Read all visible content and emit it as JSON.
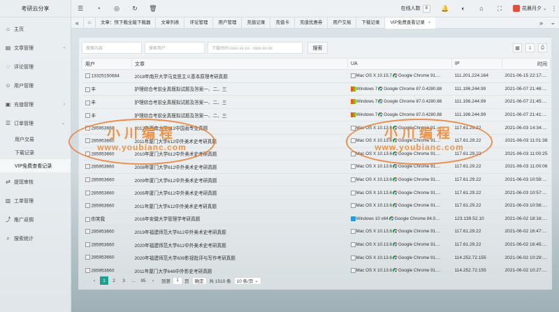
{
  "brand": "考研云分享",
  "sidebar": {
    "items": [
      {
        "label": "主页",
        "icon": "home-icon",
        "chev": ""
      },
      {
        "label": "文章管理",
        "icon": "document-icon",
        "chev": "‹"
      },
      {
        "label": "评论管理",
        "icon": "comment-icon",
        "chev": ""
      },
      {
        "label": "用户管理",
        "icon": "user-icon",
        "chev": ""
      },
      {
        "label": "充值管理",
        "icon": "wallet-icon",
        "chev": "‹"
      },
      {
        "label": "订单管理",
        "icon": "order-icon",
        "chev": "⌄"
      }
    ],
    "subitems": [
      {
        "label": "用户交易"
      },
      {
        "label": "下载记录"
      },
      {
        "label": "VIP免费查看记录"
      }
    ],
    "items2": [
      {
        "label": "提现审核",
        "icon": "withdraw-icon"
      },
      {
        "label": "工单管理",
        "icon": "ticket-icon"
      },
      {
        "label": "推广返佣",
        "icon": "share-icon"
      },
      {
        "label": "搜索统计",
        "icon": "search-stats-icon"
      }
    ]
  },
  "topbar": {
    "online_label": "在线人数",
    "online_count": "8",
    "user_name": "花晨月夕"
  },
  "tabs": [
    {
      "label": "文章：快下载全能下载器"
    },
    {
      "label": "文章列表"
    },
    {
      "label": "评论管理"
    },
    {
      "label": "用户管理"
    },
    {
      "label": "充值记录"
    },
    {
      "label": "充值卡"
    },
    {
      "label": "充值优惠券"
    },
    {
      "label": "用户交易"
    },
    {
      "label": "下载记录"
    },
    {
      "label": "VIP免费查看记录"
    }
  ],
  "search": {
    "user_placeholder": "搜索内容",
    "post_placeholder": "搜索用户",
    "time_placeholder": "下载时间 xxxx-xx-xx - xxxx-xx-xx",
    "button": "搜索"
  },
  "table": {
    "headers": [
      "用户",
      "文章",
      "UA",
      "IP",
      "时间"
    ],
    "rows": [
      {
        "user": "13325150684",
        "post": "2018年南开大学马克思主义基本原理考研真题",
        "os": "apple",
        "ua": "Mac OS X 10.15.7",
        "browser": "Google Chrome 91....",
        "ip": "111.201.224.164",
        "time": "2021-06-15 22:17:14"
      },
      {
        "user": "丰",
        "post": "护理综合考前全真模拟试题及答案一、二、三",
        "os": "win7",
        "ua": "Windows 7",
        "browser": "Google Chrome 87.0.4280.88",
        "ip": "111.196.244.99",
        "time": "2021-06-07 21:46:13"
      },
      {
        "user": "丰",
        "post": "护理综合考前全真模拟试题及答案一、二、三",
        "os": "win7",
        "ua": "Windows 7",
        "browser": "Google Chrome 87.0.4280.88",
        "ip": "111.196.244.99",
        "time": "2021-06-07 21:45:27"
      },
      {
        "user": "丰",
        "post": "护理综合考前全真模拟试题及答案一、二、三",
        "os": "win7",
        "ua": "Windows 7",
        "browser": "Google Chrome 87.0.4280.88",
        "ip": "111.196.244.99",
        "time": "2021-06-07 21:41:45"
      },
      {
        "user": "285953660",
        "post": "2012年西南大学612中国画专业真题",
        "os": "apple",
        "ua": "Mac OS X 10.13.6",
        "browser": "Google Chrome 91....",
        "ip": "117.61.29.22",
        "time": "2021-06-03 14:34:40"
      },
      {
        "user": "285953660",
        "post": "2011年厦门大学612中外美术史考研真题",
        "os": "apple",
        "ua": "Mac OS X 10.13.6",
        "browser": "Google Chrome 91....",
        "ip": "117.61.29.22",
        "time": "2021-06-03 11:01:38"
      },
      {
        "user": "285953660",
        "post": "2010年厦门大学612中外美术史考研真题",
        "os": "apple",
        "ua": "Mac OS X 10.13.6",
        "browser": "Google Chrome 91....",
        "ip": "117.61.29.22",
        "time": "2021-06-03 11:00:25"
      },
      {
        "user": "285953660",
        "post": "2008年厦门大学612中外美术史考研真题",
        "os": "apple",
        "ua": "Mac OS X 10.13.6",
        "browser": "Google Chrome 91....",
        "ip": "117.61.29.22",
        "time": "2021-06-03 11:00:06"
      },
      {
        "user": "285953660",
        "post": "2009年厦门大学612中外美术史考研真题",
        "os": "apple",
        "ua": "Mac OS X 10.13.6",
        "browser": "Google Chrome 91....",
        "ip": "117.61.29.22",
        "time": "2021-06-03 10:59:46"
      },
      {
        "user": "285953660",
        "post": "2005年厦门大学612中外美术史考研真题",
        "os": "apple",
        "ua": "Mac OS X 10.13.6",
        "browser": "Google Chrome 91....",
        "ip": "117.61.29.22",
        "time": "2021-06-03 10:57:36"
      },
      {
        "user": "285953660",
        "post": "2011年厦门大学612中外美术史考研真题",
        "os": "apple",
        "ua": "Mac OS X 10.13.6",
        "browser": "Google Chrome 91....",
        "ip": "117.61.29.22",
        "time": "2021-06-03 10:56:00"
      },
      {
        "user": "你笑我",
        "post": "2016年安徽大学管理学考研真题",
        "os": "win10",
        "ua": "Windows 10 x64",
        "browser": "Google Chrome 84.0....",
        "ip": "123.139.52.10",
        "time": "2021-06-02 18:16:47"
      },
      {
        "user": "285953660",
        "post": "2019年福建师范大学612中外美术史考研真题",
        "os": "apple",
        "ua": "Mac OS X 10.13.6",
        "browser": "Google Chrome 91....",
        "ip": "117.61.29.22",
        "time": "2021-06-02 16:47:18"
      },
      {
        "user": "285953660",
        "post": "2020年福建师范大学612中外美术史考研真题",
        "os": "apple",
        "ua": "Mac OS X 10.13.6",
        "browser": "Google Chrome 91....",
        "ip": "117.61.29.22",
        "time": "2021-06-02 16:45:55"
      },
      {
        "user": "285953660",
        "post": "2020年福建师范大学639影视批评与写作考研真题",
        "os": "apple",
        "ua": "Mac OS X 10.13.6",
        "browser": "Google Chrome 91....",
        "ip": "114.252.72.155",
        "time": "2021-06-02 10:29:45"
      },
      {
        "user": "285953660",
        "post": "2011年厦门大学648中外影史考研真题",
        "os": "apple",
        "ua": "Mac OS X 10.13.6",
        "browser": "Google Chrome 91....",
        "ip": "114.252.72.155",
        "time": "2021-06-02 10:27:43"
      }
    ]
  },
  "pager": {
    "pages": [
      "1",
      "2",
      "3",
      "...",
      "95"
    ],
    "prev": "‹",
    "next": "›",
    "goto_label": "到第",
    "goto_value": "1",
    "page_unit": "页",
    "confirm": "确定",
    "total": "共 1510 条",
    "page_size": "10 条/页"
  },
  "watermark": {
    "title": "小川编程",
    "url": "www.youbianc.com"
  }
}
